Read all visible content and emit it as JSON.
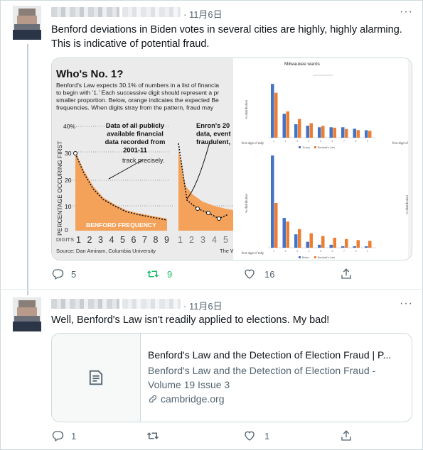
{
  "tweets": [
    {
      "date": "· 11月6日",
      "text": "Benford deviations in Biden votes in several cities are highly, highly alarming. This is indicative of potential fraud.",
      "reply_count": "5",
      "retweet_count": "9",
      "like_count": "16",
      "media": {
        "left_graphic": {
          "title": "Who's No. 1?",
          "intro_lines": [
            "Benford's Law expects 30.1% of numbers in a list of financia",
            "to begin with '1.' Each successive digit should represent a pr",
            "smaller proportion. Below, orange indicates the expected Be",
            "frequencies. When digits stray from the pattern, fraud may"
          ],
          "y_axis_label": "PERCENTAGE OCCURING FIRST",
          "y_ticks": [
            "40%",
            "30",
            "20",
            "10",
            "0"
          ],
          "panel1_note_lines": [
            "Data of all publicly",
            "available financial",
            "data recorded from",
            "2001-11"
          ],
          "panel1_pointer": "track precisely.",
          "panel2_note_lines": [
            "Enron's 20",
            "data, event",
            "fraudulent,"
          ],
          "band_label": "BENFORD FREQUENCY",
          "digits_label": "DIGITS",
          "digits1": [
            "1",
            "2",
            "3",
            "4",
            "5",
            "6",
            "7",
            "8",
            "9"
          ],
          "digits2": [
            "1",
            "2",
            "3",
            "4",
            "5"
          ],
          "source": "Source: Dan Amiram, Columbia University",
          "source_right": "The W"
        },
        "right_graphic": {
          "title": "Milwaukee wards",
          "x_label": "first digit of tally",
          "y_label": "% distribution",
          "y_label_far": "% distribution",
          "x_label_right": "first digit of",
          "legend_top": [
            "Trump",
            "Benford's Law"
          ],
          "legend_bottom": [
            "Biden",
            "Benford's Law"
          ]
        }
      }
    },
    {
      "date": "· 11月6日",
      "text": "Well, Benford's Law isn't readily applied to elections.  My bad!",
      "reply_count": "1",
      "retweet_count": "",
      "like_count": "1",
      "card": {
        "title": "Benford's Law and the Detection of Election Fraud | P...",
        "description": "Benford's Law and the Detection of Election Fraud - Volume 19 Issue 3",
        "domain": "cambridge.org"
      }
    }
  ],
  "colors": {
    "benford_orange": "#f4a25a",
    "bar_blue": "#4472c4",
    "bar_orange": "#ed7d31",
    "muted": "#536471",
    "retweet_green": "#17bf63"
  },
  "chart_data": [
    {
      "type": "bar",
      "title": "Milwaukee wards",
      "xlabel": "first digit of tally",
      "ylabel": "% distribution",
      "categories": [
        "1",
        "2",
        "3",
        "4",
        "5",
        "6",
        "7",
        "8",
        "9"
      ],
      "series": [
        {
          "name": "Trump",
          "values": [
            36,
            16,
            9,
            8,
            7,
            7,
            7,
            6,
            5
          ]
        },
        {
          "name": "Benford's Law",
          "values": [
            30.1,
            17.6,
            12.5,
            9.7,
            7.9,
            6.7,
            5.8,
            5.1,
            4.6
          ]
        }
      ]
    },
    {
      "type": "bar",
      "title": "",
      "xlabel": "first digit of tally",
      "ylabel": "% distribution",
      "categories": [
        "1",
        "2",
        "3",
        "4",
        "5",
        "6",
        "7",
        "8",
        "9"
      ],
      "series": [
        {
          "name": "Biden",
          "values": [
            62,
            20,
            9,
            4,
            2,
            2,
            1,
            1,
            1
          ]
        },
        {
          "name": "Benford's Law",
          "values": [
            30.1,
            17.6,
            12.5,
            9.7,
            7.9,
            6.7,
            5.8,
            5.1,
            4.6
          ]
        }
      ]
    }
  ]
}
